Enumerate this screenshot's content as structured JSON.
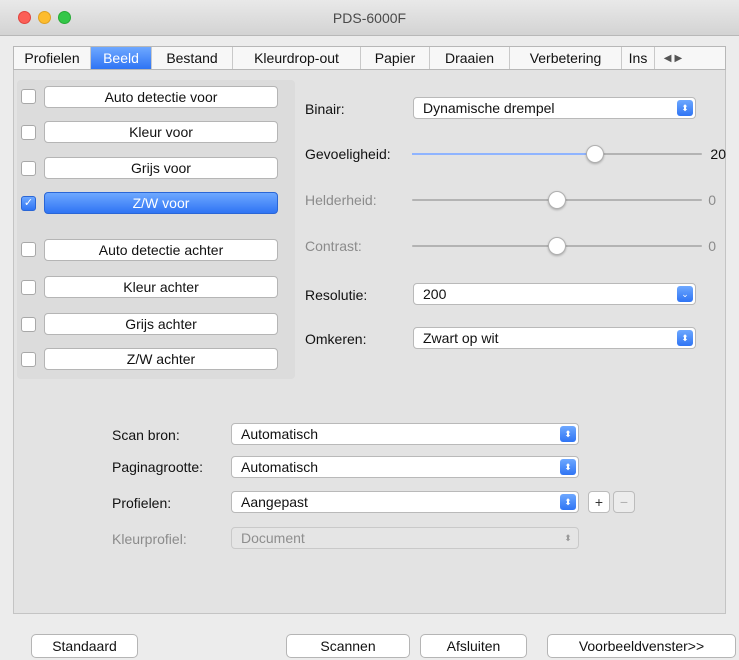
{
  "window": {
    "title": "PDS-6000F"
  },
  "tabs": [
    {
      "label": "Profielen"
    },
    {
      "label": "Beeld"
    },
    {
      "label": "Bestand"
    },
    {
      "label": "Kleurdrop-out"
    },
    {
      "label": "Papier"
    },
    {
      "label": "Draaien"
    },
    {
      "label": "Verbetering"
    },
    {
      "label": "Ins"
    }
  ],
  "scan_modes": [
    {
      "label": "Auto detectie voor",
      "checked": false
    },
    {
      "label": "Kleur voor",
      "checked": false
    },
    {
      "label": "Grijs voor",
      "checked": false
    },
    {
      "label": "Z/W voor",
      "checked": true
    },
    {
      "label": "Auto detectie achter",
      "checked": false
    },
    {
      "label": "Kleur achter",
      "checked": false
    },
    {
      "label": "Grijs achter",
      "checked": false
    },
    {
      "label": "Z/W achter",
      "checked": false
    }
  ],
  "image": {
    "binair": {
      "label": "Binair:",
      "value": "Dynamische drempel"
    },
    "gevoeligheid": {
      "label": "Gevoeligheid:",
      "value": "20",
      "level": 0.63
    },
    "helderheid": {
      "label": "Helderheid:",
      "value": "0",
      "level": 0.5
    },
    "contrast": {
      "label": "Contrast:",
      "value": "0",
      "level": 0.5
    },
    "resolutie": {
      "label": "Resolutie:",
      "value": "200"
    },
    "omkeren": {
      "label": "Omkeren:",
      "value": "Zwart op wit"
    }
  },
  "scan": {
    "bron": {
      "label": "Scan bron:",
      "value": "Automatisch"
    },
    "pagina": {
      "label": "Paginagrootte:",
      "value": "Automatisch"
    },
    "profielen": {
      "label": "Profielen:",
      "value": "Aangepast",
      "add": "+",
      "remove": "−"
    },
    "kleurprofiel": {
      "label": "Kleurprofiel:",
      "value": "Document"
    }
  },
  "buttons": {
    "standaard": "Standaard",
    "scannen": "Scannen",
    "afsluiten": "Afsluiten",
    "voorbeeld": "Voorbeeldvenster>>"
  },
  "colors": {
    "accent": "#2f74f4",
    "knob": "#ffffff"
  }
}
